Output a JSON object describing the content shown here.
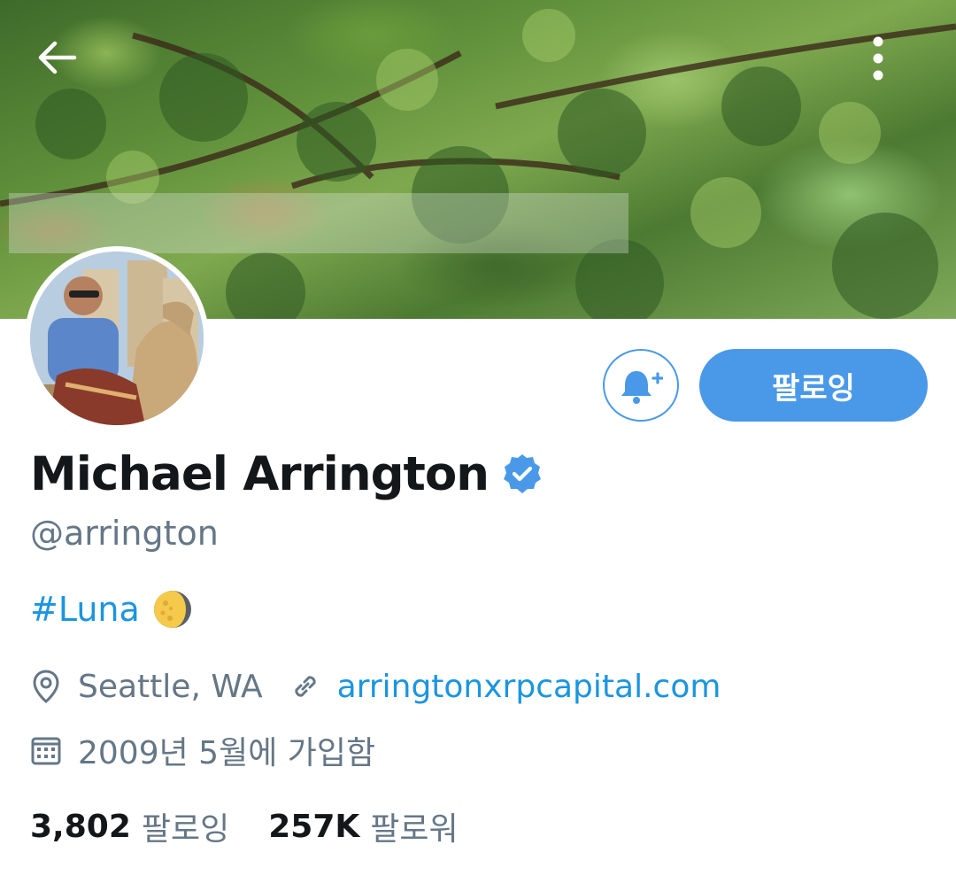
{
  "header": {
    "back_icon": "arrow-left-icon",
    "more_icon": "vertical-dots-icon"
  },
  "profile": {
    "display_name": "Michael Arrington",
    "verified": true,
    "handle": "@arrington",
    "bio_hashtag": "#Luna",
    "bio_emoji": "moon-emoji",
    "location": "Seattle, WA",
    "website": "arringtonxrpcapital.com",
    "joined": "2009년 5월에 가입함"
  },
  "actions": {
    "notify_icon": "bell-plus-icon",
    "follow_label": "팔로잉"
  },
  "stats": {
    "following_count": "3,802",
    "following_label": "팔로잉",
    "followers_count": "257K",
    "followers_label": "팔로워"
  },
  "colors": {
    "accent": "#4a99e9",
    "link": "#1b95e0",
    "text_primary": "#14171a",
    "text_secondary": "#657786"
  }
}
